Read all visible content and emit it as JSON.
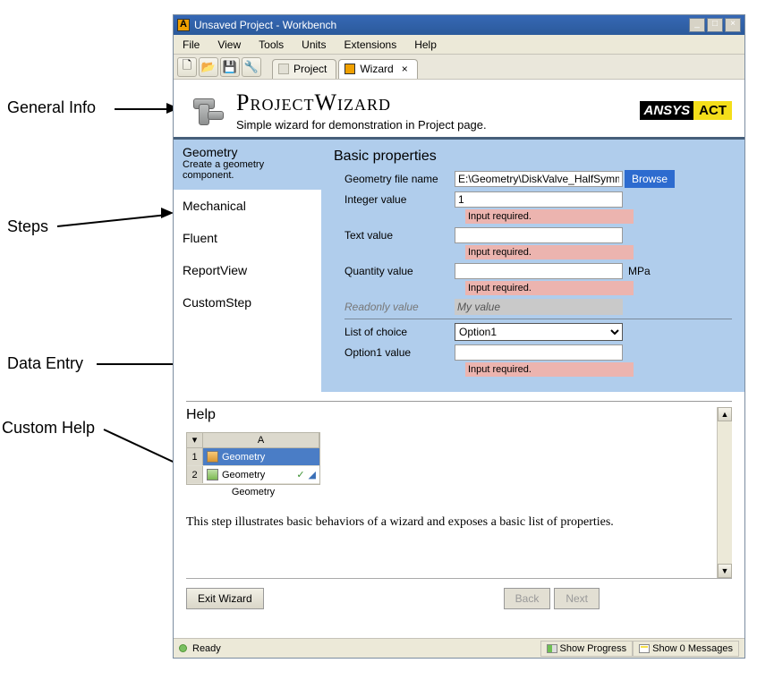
{
  "annotations": {
    "general": "General Info",
    "steps": "Steps",
    "dataEntry": "Data Entry",
    "customHelp": "Custom Help"
  },
  "window": {
    "title": "Unsaved Project - Workbench"
  },
  "menu": {
    "file": "File",
    "view": "View",
    "tools": "Tools",
    "units": "Units",
    "extensions": "Extensions",
    "help": "Help"
  },
  "tabs": {
    "project": "Project",
    "wizard": "Wizard"
  },
  "header": {
    "title": "ProjectWizard",
    "subtitle": "Simple wizard for demonstration in Project page.",
    "logo1": "ANSYS",
    "logo2": "ACT"
  },
  "steps_panel": {
    "active": {
      "name": "Geometry",
      "desc": "Create a geometry component."
    },
    "items": [
      "Mechanical",
      "Fluent",
      "ReportView",
      "CustomStep"
    ]
  },
  "form": {
    "title": "Basic properties",
    "geoname_lbl": "Geometry file name",
    "geoname_val": "E:\\Geometry\\DiskValve_HalfSymm.s",
    "browse": "Browse",
    "int_lbl": "Integer value",
    "int_val": "1",
    "txt_lbl": "Text value",
    "txt_val": "",
    "qty_lbl": "Quantity value",
    "qty_val": "",
    "qty_unit": "MPa",
    "ro_lbl": "Readonly value",
    "ro_val": "My value",
    "choice_lbl": "List of choice",
    "choice_val": "Option1",
    "opt1_lbl": "Option1 value",
    "opt1_val": "",
    "errmsg": "Input required."
  },
  "help": {
    "title": "Help",
    "colA": "A",
    "r1": "Geometry",
    "r2": "Geometry",
    "check": "✓",
    "caption": "Geometry",
    "body": "This step illustrates basic behaviors of a wizard and exposes a basic list of properties."
  },
  "footer": {
    "exit": "Exit Wizard",
    "back": "Back",
    "next": "Next"
  },
  "status": {
    "ready": "Ready",
    "progress": "Show Progress",
    "messages": "Show 0 Messages"
  }
}
